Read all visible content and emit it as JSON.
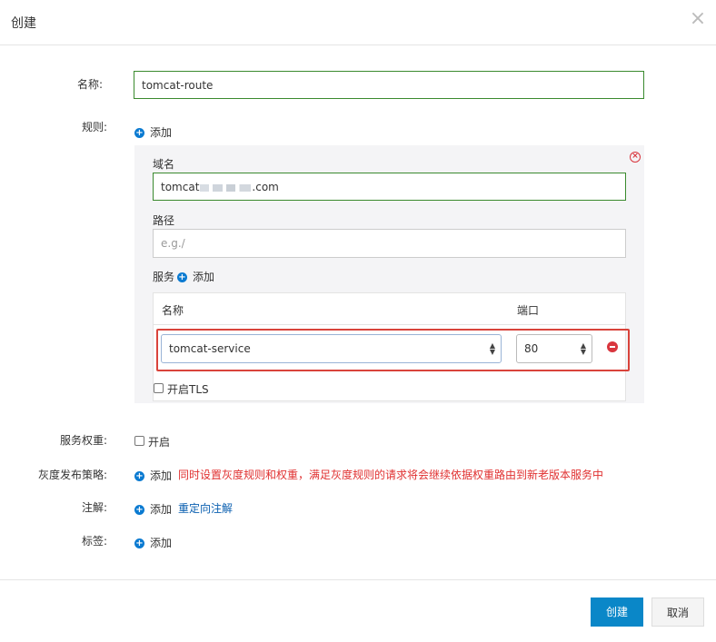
{
  "dialog": {
    "title": "创建",
    "close_symbol": "×"
  },
  "form": {
    "name_label": "名称:",
    "name_value": "tomcat-route",
    "rules_label": "规则:",
    "add_label": "添加",
    "rule": {
      "domain_label": "域名",
      "domain_value_prefix": "tomcat",
      "domain_value_suffix": ".com",
      "path_label": "路径",
      "path_placeholder": "e.g./",
      "service_label": "服务",
      "service_add": "添加",
      "col_name": "名称",
      "col_port": "端口",
      "service_name": "tomcat-service",
      "service_port": "80",
      "tls_label": "开启TLS"
    },
    "weight_label": "服务权重:",
    "weight_checkbox_label": "开启",
    "canary_label": "灰度发布策略:",
    "canary_add": "添加",
    "canary_hint": "同时设置灰度规则和权重，满足灰度规则的请求将会继续依据权重路由到新老版本服务中",
    "annotations_label": "注解:",
    "annotations_add": "添加",
    "annotations_link": "重定向注解",
    "tags_label": "标签:",
    "tags_add": "添加"
  },
  "footer": {
    "create_button": "创建",
    "cancel_button": "取消"
  },
  "icons": {
    "add": "plus-circle-icon",
    "remove_rule": "close-circle-icon",
    "remove_service": "minus-circle-icon",
    "close": "close-icon"
  },
  "colors": {
    "accent": "#0a87c8",
    "valid_border": "#3a8a2e",
    "error": "#d9363e",
    "hint": "#e03030"
  }
}
